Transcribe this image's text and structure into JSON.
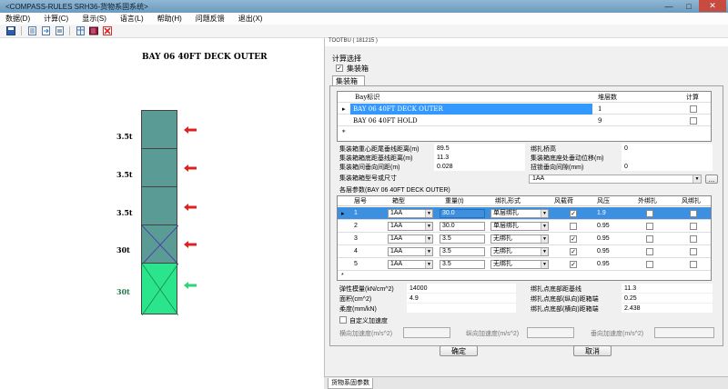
{
  "window": {
    "title": "<COMPASS-RULES SRH36-货物系固系统>",
    "controls": {
      "min": "—",
      "max": "□",
      "close": "✕"
    }
  },
  "menu": [
    "数据(D)",
    "计算(C)",
    "显示(S)",
    "语言(L)",
    "帮助(H)",
    "问题反馈",
    "退出(X)"
  ],
  "toolbar_icons": [
    "save-icon",
    "document-icon",
    "export-icon",
    "print-icon",
    "book-icon",
    "book-icon",
    "exit-icon"
  ],
  "drawing": {
    "title": "BAY 06 40FT DECK OUTER",
    "tiers": [
      {
        "weight": "3.5t",
        "color": "#5b9b96",
        "arrow": "red"
      },
      {
        "weight": "3.5t",
        "color": "#5b9b96",
        "arrow": "red"
      },
      {
        "weight": "3.5t",
        "color": "#5b9b96",
        "arrow": "red"
      },
      {
        "weight": "30t",
        "color": "#5b9b96",
        "arrow": "red"
      },
      {
        "weight": "30t",
        "color": "#2be58c",
        "arrow": "green"
      }
    ]
  },
  "dialog": {
    "header_text": "TOOTBU ( 181215 )",
    "calc_section_label": "计算选择",
    "container_checkbox_label": "集装箱",
    "tab_label": "集装箱",
    "bay_grid": {
      "headers": {
        "bay": "Bay标识",
        "tiers": "堆层数",
        "calc": "计算"
      },
      "rows": [
        {
          "bay": "BAY 06 40FT DECK OUTER",
          "tiers": "1"
        },
        {
          "bay": "BAY 06 40FT HOLD",
          "tiers": "9"
        }
      ],
      "new_row_marker": "*"
    },
    "params_left": [
      {
        "label": "集装箱重心距尾垂线距离(m)",
        "value": "89.5"
      },
      {
        "label": "集装箱箱底距基线距离(m)",
        "value": "11.3"
      },
      {
        "label": "集装箱间垂向间距(m)",
        "value": "0.028"
      }
    ],
    "params_right": [
      {
        "label": "绑扎桥高",
        "value": "0"
      },
      {
        "label": "集装箱底座处垂动位移(m)",
        "value": ""
      },
      {
        "label": "扭锁垂向间隙(mm)",
        "value": "0"
      }
    ],
    "type_label": "集装箱箱型号或尺寸",
    "type_value": "1AA",
    "type_button": "...",
    "tier_section_label": "各层参数(BAY 06 40FT DECK OUTER)",
    "tier_grid": {
      "headers": [
        "层号",
        "箱型",
        "重量(t)",
        "绑扎形式",
        "风载荷",
        "风压",
        "外绑扎",
        "风绑扎"
      ],
      "rows": [
        {
          "no": "1",
          "type": "1AA",
          "weight": "30.0",
          "lashing": "单层绑扎",
          "wind": true,
          "pressure": "1.9"
        },
        {
          "no": "2",
          "type": "1AA",
          "weight": "30.0",
          "lashing": "单层绑扎",
          "wind": false,
          "pressure": "0.95"
        },
        {
          "no": "3",
          "type": "1AA",
          "weight": "3.5",
          "lashing": "无绑扎",
          "wind": true,
          "pressure": "0.95"
        },
        {
          "no": "4",
          "type": "1AA",
          "weight": "3.5",
          "lashing": "无绑扎",
          "wind": true,
          "pressure": "0.95"
        },
        {
          "no": "5",
          "type": "1AA",
          "weight": "3.5",
          "lashing": "无绑扎",
          "wind": true,
          "pressure": "0.95"
        }
      ],
      "new_row_marker": "*"
    },
    "lower_left": [
      {
        "label": "弹性模量(kN/cm^2)",
        "value": "14000"
      },
      {
        "label": "面积(cm^2)",
        "value": "4.9"
      },
      {
        "label": "柔度(mm/kN)",
        "value": ""
      }
    ],
    "lower_right": [
      {
        "label": "绑扎点底部距基线",
        "value": "11.3"
      },
      {
        "label": "绑扎点底部(纵向)距箱端",
        "value": "0.25"
      },
      {
        "label": "绑扎点底部(横向)距箱端",
        "value": "2.438"
      }
    ],
    "custom_accel_label": "自定义加速度",
    "accel_fields": [
      "横向加速度(m/s^2)",
      "纵向加速度(m/s^2)",
      "垂向加速度(m/s^2)"
    ],
    "ok_label": "确定",
    "cancel_label": "取消",
    "bottom_tab": "货物系固参数"
  }
}
